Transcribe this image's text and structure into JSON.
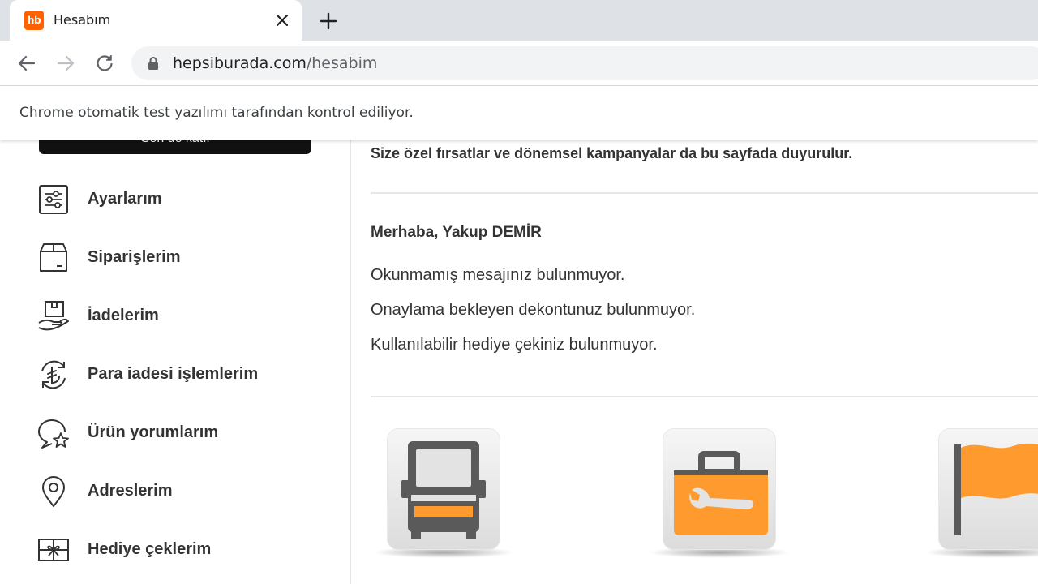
{
  "browser": {
    "tab": {
      "favicon_text": "hb",
      "title": "Hesabım"
    },
    "url": {
      "host": "hepsiburada.com",
      "path": "/hesabim"
    },
    "infobar": "Chrome otomatik test yazılımı tarafından kontrol ediliyor."
  },
  "sidebar": {
    "join_button": "Sen de katıl",
    "items": [
      {
        "label": "Ayarlarım",
        "icon": "settings-sliders-icon"
      },
      {
        "label": "Siparişlerim",
        "icon": "package-box-icon"
      },
      {
        "label": "İadelerim",
        "icon": "return-hand-box-icon"
      },
      {
        "label": "Para iadesi işlemlerim",
        "icon": "lira-refund-icon"
      },
      {
        "label": "Ürün yorumlarım",
        "icon": "review-star-icon"
      },
      {
        "label": "Adreslerim",
        "icon": "location-pin-icon"
      },
      {
        "label": "Hediye çeklerim",
        "icon": "gift-card-icon"
      }
    ]
  },
  "main": {
    "promo": "Size özel fırsatlar ve dönemsel kampanyalar da bu sayfada duyurulur.",
    "greeting": "Merhaba, Yakup DEMİR",
    "status_lines": [
      "Okunmamış mesajınız bulunmuyor.",
      "Onaylama bekleyen dekontunuz bulunmuyor.",
      "Kullanılabilir hediye çekiniz bulunmuyor."
    ],
    "tiles": [
      "truck-icon",
      "toolbox-wrench-icon",
      "flag-icon"
    ]
  },
  "colors": {
    "brand": "#ff6000",
    "tile_orange": "#ff9a2e",
    "text": "#333333"
  }
}
